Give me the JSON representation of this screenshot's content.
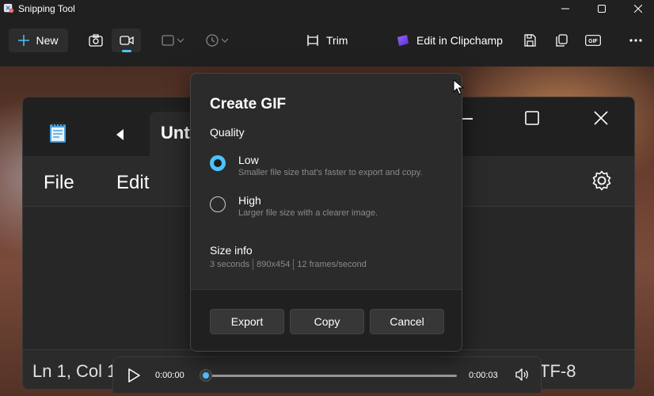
{
  "window": {
    "title": "Snipping Tool",
    "controls": {
      "minimize": "minimize-icon",
      "maximize": "maximize-icon",
      "close": "close-icon"
    }
  },
  "toolbar": {
    "new_label": "New",
    "trim_label": "Trim",
    "clipchamp_label": "Edit in Clipchamp",
    "gif_label": "GIF",
    "icons": [
      "camera-icon",
      "video-icon",
      "snip-mode-icon",
      "delay-icon",
      "trim-icon",
      "clipchamp-icon",
      "save-icon",
      "copy-icon",
      "gif-icon",
      "more-icon"
    ]
  },
  "captured": {
    "tab_label": "Unt",
    "menu_file": "File",
    "menu_edit": "Edit",
    "status_position": "Ln 1, Col 1",
    "status_encoding": "TF-8"
  },
  "media": {
    "current_time": "0:00:00",
    "end_time": "0:00:03",
    "progress": 0
  },
  "dialog": {
    "title": "Create GIF",
    "quality_label": "Quality",
    "options": [
      {
        "label": "Low",
        "description": "Smaller file size that's faster to export and copy.",
        "selected": true
      },
      {
        "label": "High",
        "description": "Larger file size with a clearer image.",
        "selected": false
      }
    ],
    "size_info_label": "Size info",
    "size_info": [
      "3 seconds",
      "890x454",
      "12 frames/second"
    ],
    "buttons": {
      "export": "Export",
      "copy": "Copy",
      "cancel": "Cancel"
    }
  },
  "colors": {
    "accent": "#4cc2ff",
    "surface": "#2b2b2b",
    "chrome": "#202020"
  }
}
